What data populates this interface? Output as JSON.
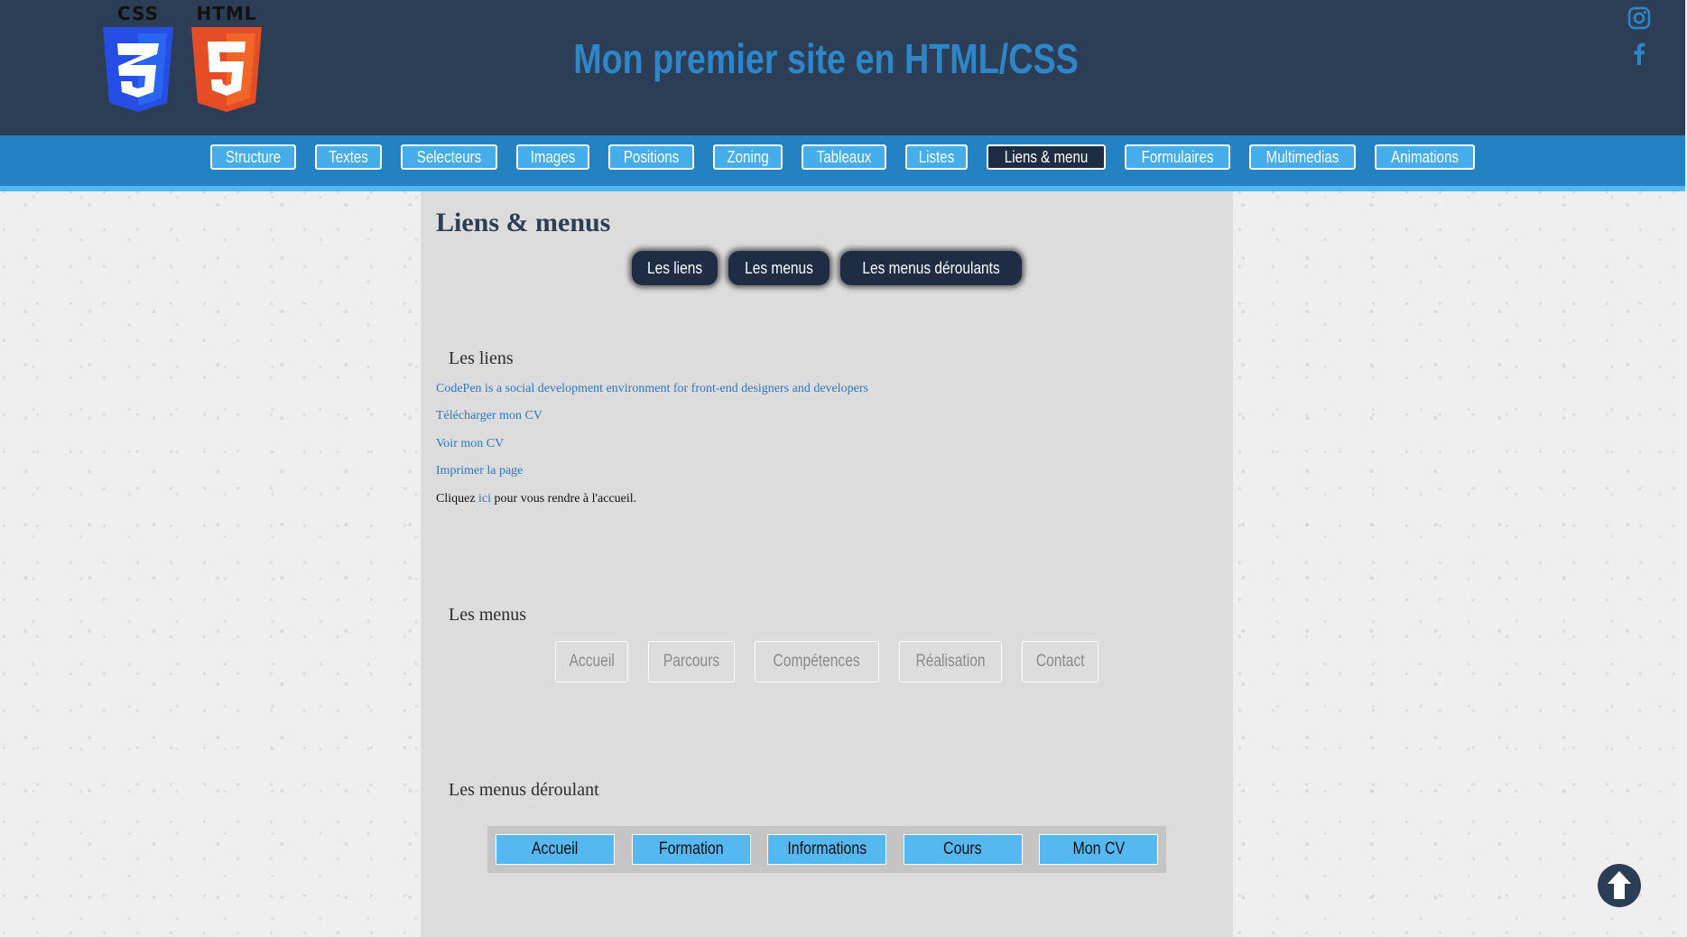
{
  "header": {
    "logos": [
      {
        "label": "CSS",
        "icon": "css3-logo",
        "digit": "3",
        "color": "#264de4"
      },
      {
        "label": "HTML",
        "icon": "html5-logo",
        "digit": "5",
        "color": "#e44d26"
      }
    ],
    "title": "Mon premier site en HTML/CSS",
    "social": [
      {
        "icon": "instagram-icon"
      },
      {
        "icon": "facebook-icon"
      }
    ]
  },
  "nav": {
    "items": [
      {
        "label": "Structure"
      },
      {
        "label": "Textes"
      },
      {
        "label": "Selecteurs"
      },
      {
        "label": "Images"
      },
      {
        "label": "Positions"
      },
      {
        "label": "Zoning"
      },
      {
        "label": "Tableaux"
      },
      {
        "label": "Listes"
      },
      {
        "label": "Liens & menu",
        "active": true
      },
      {
        "label": "Formulaires"
      },
      {
        "label": "Multimedias"
      },
      {
        "label": "Animations"
      }
    ]
  },
  "main": {
    "heading": "Liens & menus",
    "tabs": [
      {
        "label": "Les liens"
      },
      {
        "label": "Les menus"
      },
      {
        "label": "Les menus déroulants"
      }
    ],
    "links_section": {
      "title": "Les liens",
      "links": [
        "CodePen is a social development environment for front-end designers and developers",
        "Télécharger mon CV",
        "Voir mon CV",
        "Imprimer la page"
      ],
      "home_line": {
        "before": "Cliquez ",
        "link": "ici",
        "after": " pour vous rendre à l'accueil."
      }
    },
    "menus_section": {
      "title": "Les menus",
      "items": [
        "Accueil",
        "Parcours",
        "Compétences",
        "Réalisation",
        "Contact"
      ]
    },
    "dropdown_section": {
      "title": "Les menus déroulant",
      "items": [
        "Accueil",
        "Formation",
        "Informations",
        "Cours",
        "Mon CV"
      ]
    }
  },
  "colors": {
    "header_bg": "#2c3e55",
    "nav_bg": "#2481c2",
    "accent": "#2e86c8",
    "button_blue": "#55b8f0"
  },
  "back_to_top": {
    "icon": "arrow-up-circle-icon"
  }
}
